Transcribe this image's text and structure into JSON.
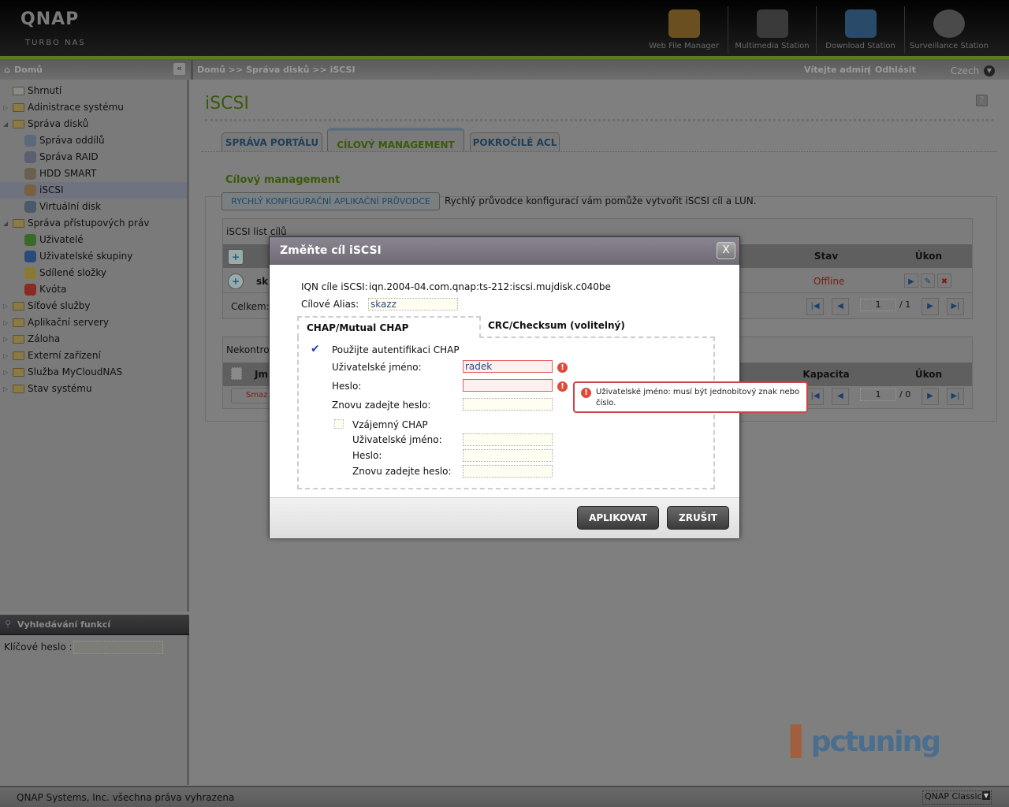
{
  "header": {
    "logo": "QNAP",
    "logo_sub": "TURBO NAS",
    "apps": [
      "Web File Manager",
      "Multimedia Station",
      "Download Station",
      "Surveillance Station"
    ]
  },
  "subbar": {
    "home": "Domů",
    "breadcrumb": "Domů >> Správa disků >> iSCSI",
    "welcome": "Vítejte admin",
    "separator": "|",
    "logout": "Odhlásit",
    "language": "Czech"
  },
  "sidebar": {
    "items": [
      {
        "label": "Shrnutí",
        "level": 0,
        "icon": "summary-icon"
      },
      {
        "label": "Adinistrace systému",
        "level": 0,
        "icon": "folder-icon",
        "tw": "▷"
      },
      {
        "label": "Správa disků",
        "level": 0,
        "icon": "folder-open-icon",
        "tw": "◢"
      },
      {
        "label": "Správa oddílů",
        "level": 1,
        "icon": "volume-icon",
        "color": "#5a6a7a"
      },
      {
        "label": "Správa RAID",
        "level": 1,
        "icon": "raid-icon",
        "color": "#5a6070"
      },
      {
        "label": "HDD SMART",
        "level": 1,
        "icon": "hdd-smart-icon",
        "color": "#6a6050"
      },
      {
        "label": "iSCSI",
        "level": 1,
        "icon": "iscsi-icon",
        "color": "#7a6040",
        "selected": true
      },
      {
        "label": "Virtuální disk",
        "level": 1,
        "icon": "virtual-disk-icon",
        "color": "#4a5a6a"
      },
      {
        "label": "Správa přístupových práv",
        "level": 0,
        "icon": "folder-open-icon",
        "tw": "◢"
      },
      {
        "label": "Uživatelé",
        "level": 1,
        "icon": "user-icon",
        "color": "#3a6a2a"
      },
      {
        "label": "Uživatelské skupiny",
        "level": 1,
        "icon": "user-group-icon",
        "color": "#2a4a7a"
      },
      {
        "label": "Sdílené složky",
        "level": 1,
        "icon": "shared-folder-icon",
        "color": "#8a7a30"
      },
      {
        "label": "Kvóta",
        "level": 1,
        "icon": "quota-icon",
        "color": "#8a2a20"
      },
      {
        "label": "Síťové služby",
        "level": 0,
        "icon": "folder-icon",
        "tw": "▷"
      },
      {
        "label": "Aplikační servery",
        "level": 0,
        "icon": "folder-icon",
        "tw": "▷"
      },
      {
        "label": "Záloha",
        "level": 0,
        "icon": "folder-icon",
        "tw": "▷"
      },
      {
        "label": "Externí zařízení",
        "level": 0,
        "icon": "folder-icon",
        "tw": "▷"
      },
      {
        "label": "Služba MyCloudNAS",
        "level": 0,
        "icon": "folder-icon",
        "tw": "▷"
      },
      {
        "label": "Stav systému",
        "level": 0,
        "icon": "folder-icon",
        "tw": "▷"
      }
    ]
  },
  "search": {
    "title": "Vyhledávání funkcí",
    "keyword_label": "Klíčové heslo :",
    "keyword_value": ""
  },
  "main": {
    "title": "iSCSI",
    "tabs": [
      "SPRÁVA PORTÁLU",
      "CÍLOVÝ MANAGEMENT",
      "POKROČILÉ ACL"
    ],
    "active_tab": 1,
    "section": "Cílový management",
    "wizard_button": "RYCHLÝ KONFIGURAČNÍ APLIKAČNÍ PRŮVODCE",
    "wizard_desc": "Rychlý průvodce konfigurací vám pomůže vytvořit iSCSI cíl a LUN.",
    "targets": {
      "title": "iSCSI list cílů",
      "col_status": "Stav",
      "col_action": "Úkon",
      "row_name": "sk",
      "row_status": "Offline",
      "total": "Celkem:",
      "page": "1",
      "pages": "/ 1"
    },
    "unmapped": {
      "title": "Nekontrol",
      "col_name": "Jm",
      "col_capacity": "Kapacita",
      "col_action": "Úkon",
      "delete": "Smaz",
      "page": "1",
      "pages": "/ 0"
    }
  },
  "modal": {
    "title": "Změňte cíl iSCSI",
    "close": "X",
    "iqn_label": "IQN cíle iSCSI:",
    "iqn_value": "iqn.2004-04.com.qnap:ts-212:iscsi.mujdisk.c040be",
    "alias_label": "Cílové Alias:",
    "alias_value": "skazz",
    "tab_chap": "CHAP/Mutual CHAP",
    "tab_crc": "CRC/Checksum (volitelný)",
    "use_chap": "Použijte autentifikaci CHAP",
    "use_chap_checked": true,
    "username_label": "Uživatelské jméno:",
    "username_value": "radek",
    "password_label": "Heslo:",
    "retype_label": "Znovu zadejte heslo:",
    "mutual_chap": "Vzájemný CHAP",
    "mutual_chap_checked": false,
    "m_username_label": "Uživatelské jméno:",
    "m_password_label": "Heslo:",
    "m_retype_label": "Znovu zadejte heslo:",
    "error": "Uživatelské jméno: musí být jednobitový znak nebo číslo.",
    "apply": "APLIKOVAT",
    "cancel": "ZRUŠIT"
  },
  "footer": {
    "copyright": "QNAP Systems, Inc. všechna práva vyhrazena",
    "theme": "QNAP Classic"
  },
  "watermark": "pctuning"
}
